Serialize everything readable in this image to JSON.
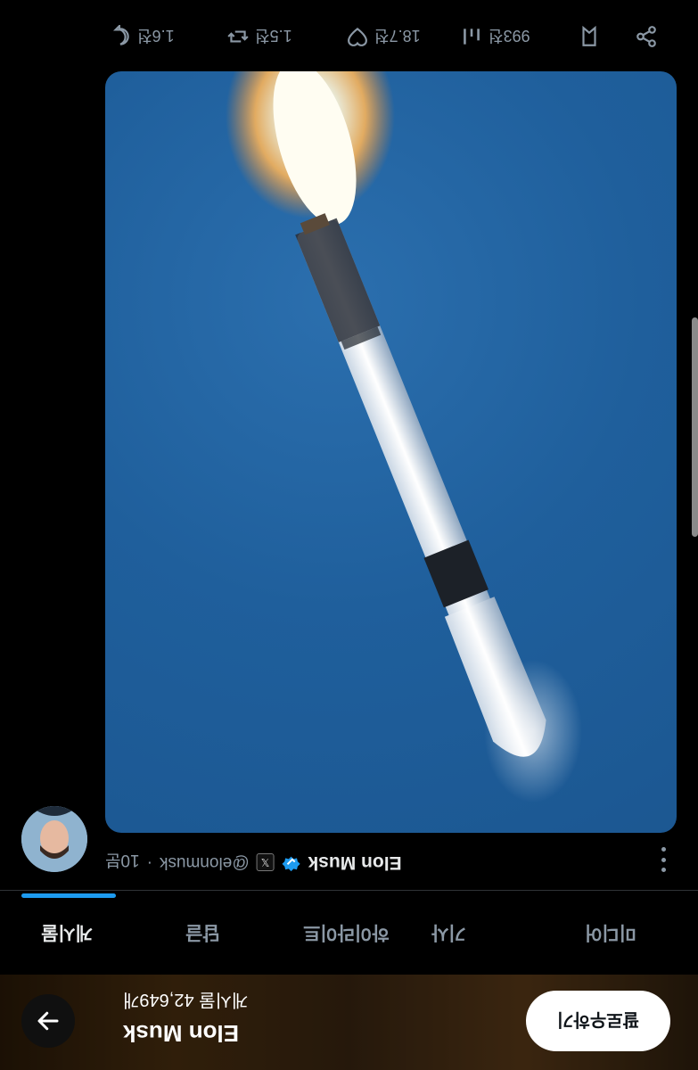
{
  "actions": {
    "replies": "1.6천",
    "reposts": "1.5천",
    "likes": "18.7천",
    "views": "993천"
  },
  "tweet": {
    "author_name": "Elon Musk",
    "handle": "@elonmusk",
    "time_separator": "·",
    "time": "10분"
  },
  "tabs": [
    {
      "label": "게시물"
    },
    {
      "label": "답글"
    },
    {
      "label": "하이라이트"
    },
    {
      "label": "기사"
    },
    {
      "label": "미디어"
    }
  ],
  "profile_bar": {
    "name": "Elon Musk",
    "post_count": "게시물 42,649개",
    "follow_label": "팔로우하기"
  },
  "colors": {
    "accent": "#1d9bf0",
    "sky": "#1f5f9c"
  }
}
